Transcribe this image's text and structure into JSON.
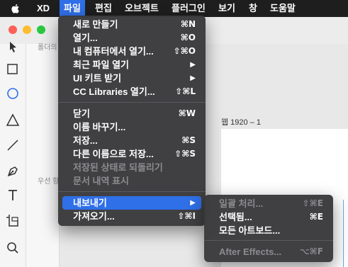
{
  "menubar": {
    "apple_icon": "apple-icon",
    "items": [
      "XD",
      "파일",
      "편집",
      "오브젝트",
      "플러그인",
      "보기",
      "창",
      "도움말"
    ],
    "active_item": "파일",
    "colors": {
      "background": "#1e1e1e",
      "active": "#2f6fe8"
    }
  },
  "window": {
    "traffic_lights": {
      "close": "#fd5f57",
      "minimize": "#febc2e",
      "zoom": "#29c840"
    }
  },
  "layers": {
    "partial_labels": [
      "폴더의 ...",
      "우선 항..."
    ]
  },
  "canvas": {
    "artboard_label": "웹 1920 – 1"
  },
  "file_menu": {
    "items": [
      {
        "label": "새로 만들기",
        "shortcut": "⌘N",
        "enabled": true
      },
      {
        "label": "열기...",
        "shortcut": "⌘O",
        "enabled": true
      },
      {
        "label": "내 컴퓨터에서 열기...",
        "shortcut": "⇧⌘O",
        "enabled": true
      },
      {
        "label": "최근 파일 열기",
        "shortcut": "",
        "submenu": true,
        "enabled": true
      },
      {
        "label": "UI 키트 받기",
        "shortcut": "",
        "submenu": true,
        "enabled": true
      },
      {
        "label": "CC Libraries 열기...",
        "shortcut": "⇧⌘L",
        "enabled": true
      },
      {
        "label": "닫기",
        "shortcut": "⌘W",
        "enabled": true
      },
      {
        "label": "이름 바꾸기...",
        "shortcut": "",
        "enabled": true
      },
      {
        "label": "저장...",
        "shortcut": "⌘S",
        "enabled": true
      },
      {
        "label": "다른 이름으로 저장...",
        "shortcut": "⇧⌘S",
        "enabled": true
      },
      {
        "label": "저장된 상태로 되돌리기",
        "shortcut": "",
        "enabled": false
      },
      {
        "label": "문서 내역 표시",
        "shortcut": "",
        "enabled": false
      },
      {
        "label": "내보내기",
        "shortcut": "",
        "submenu": true,
        "enabled": true,
        "highlighted": true
      },
      {
        "label": "가져오기...",
        "shortcut": "⇧⌘I",
        "enabled": true
      }
    ]
  },
  "export_submenu": {
    "items": [
      {
        "label": "일괄 처리...",
        "shortcut": "⇧⌘E",
        "enabled": false
      },
      {
        "label": "선택됨...",
        "shortcut": "⌘E",
        "enabled": true
      },
      {
        "label": "모든 아트보드...",
        "shortcut": "",
        "enabled": true
      },
      {
        "label": "After Effects...",
        "shortcut": "⌥⌘F",
        "enabled": false
      }
    ]
  },
  "submenu_arrow": "▶",
  "tools": [
    "select-icon",
    "rectangle-icon",
    "ellipse-icon",
    "triangle-icon",
    "line-icon",
    "pen-icon",
    "text-icon",
    "artboard-icon",
    "zoom-icon"
  ]
}
